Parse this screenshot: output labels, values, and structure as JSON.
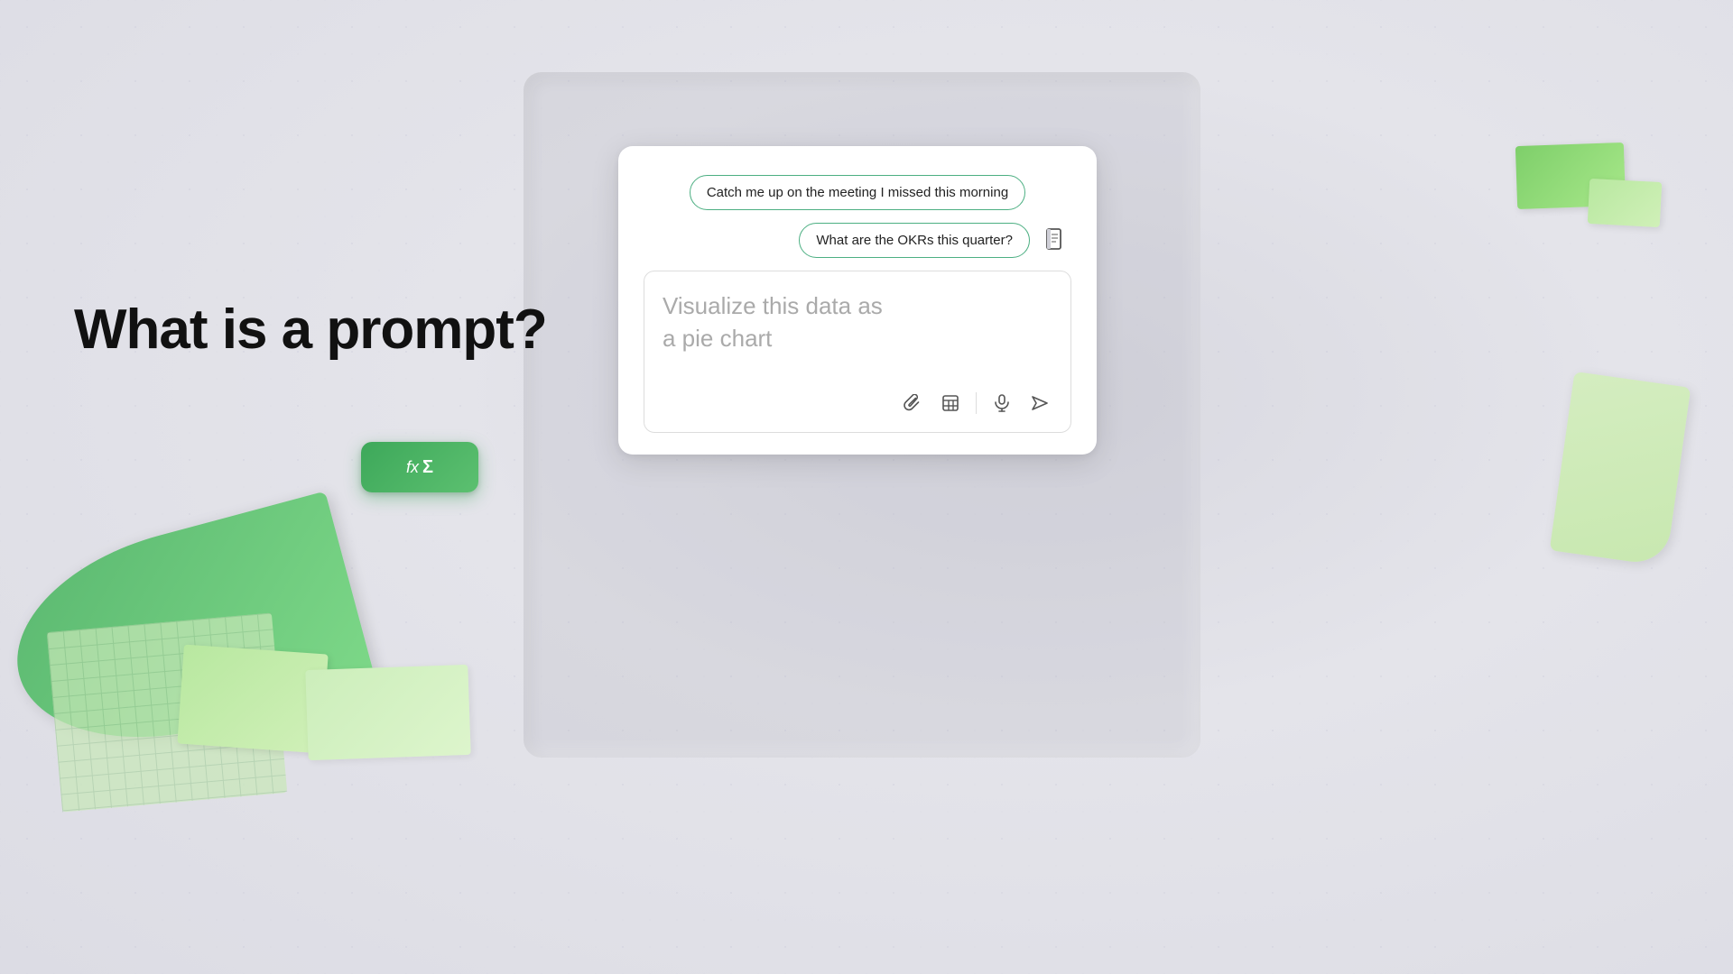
{
  "heading": {
    "line1": "What is a prompt?"
  },
  "chips": {
    "chip1": "Catch me up on the meeting I missed this morning",
    "chip2": "What are the OKRs this quarter?"
  },
  "input": {
    "placeholder": "Visualize this data as\na pie chart"
  },
  "toolbar": {
    "attach_label": "Attach",
    "table_label": "Table",
    "mic_label": "Microphone",
    "send_label": "Send"
  },
  "excel_btn": {
    "fx": "fx",
    "sigma": "Σ"
  },
  "colors": {
    "chip_border": "#4caf82",
    "green_accent": "#3da85a"
  }
}
